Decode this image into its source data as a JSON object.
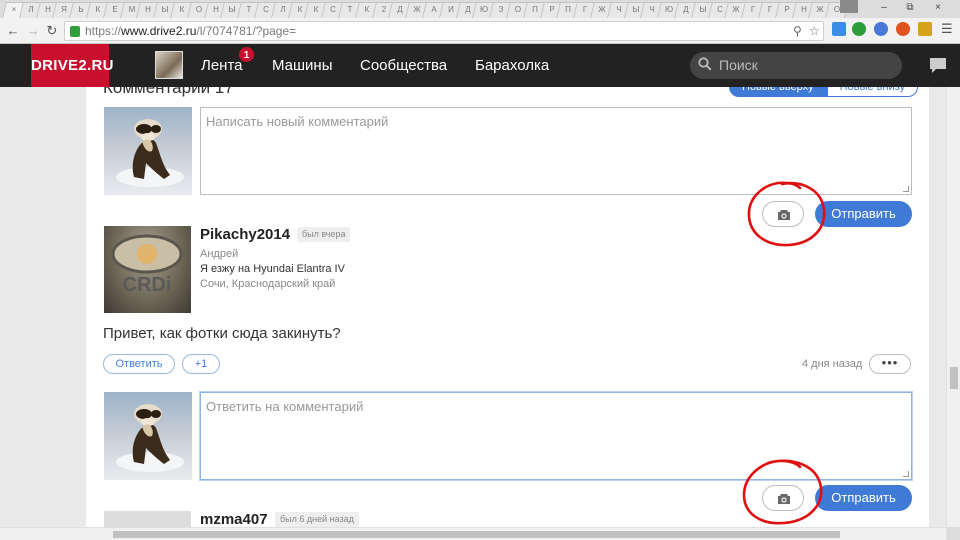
{
  "browser": {
    "url_prefix": "https://",
    "url_host": "www.drive2.ru",
    "url_path": "/l/7074781/?page=",
    "tab_glyphs": [
      "×",
      "Л",
      "Н",
      "Я",
      "Ь",
      "К",
      "Е",
      "М",
      "Н",
      "Ы",
      "К",
      "О",
      "Н",
      "Ы",
      "Т",
      "С",
      "Л",
      "К",
      "К",
      "С",
      "Т",
      "К",
      "2",
      "Д",
      "Ж",
      "А",
      "И",
      "Д",
      "Ю",
      "З",
      "О",
      "П",
      "Р",
      "П",
      "Г",
      "Ж",
      "Ч",
      "Ы",
      "Ч",
      "Ю",
      "Д",
      "Ы",
      "С",
      "Ж",
      "Г",
      "Г",
      "Р",
      "Н",
      "Ж",
      "О"
    ],
    "window_controls": [
      "–",
      "⧉",
      "×"
    ]
  },
  "header": {
    "logo": "DRIVE2.RU",
    "nav": [
      "Лента",
      "Машины",
      "Сообщества",
      "Барахолка"
    ],
    "notification_count": "1",
    "search_placeholder": "Поиск"
  },
  "comments_section": {
    "title_partial": "Комментарии  17",
    "sort_options": [
      "Новые вверху",
      "Новые внизу"
    ],
    "new_comment_placeholder": "Написать новый комментарий",
    "send_label": "Отправить"
  },
  "comment": {
    "username": "Pikachy2014",
    "last_seen": "был вчера",
    "real_name": "Андрей",
    "car": "Я езжу на Hyundai Elantra IV",
    "location": "Сочи, Краснодарский край",
    "text": "Привет, как фотки сюда закинуть?",
    "reply_label": "Ответить",
    "like_label": "+1",
    "time": "4 дня назад",
    "more_label": "•••",
    "reply_placeholder": "Ответить на комментарий",
    "photo_text": "CRDi"
  },
  "next_comment": {
    "username": "mzma407",
    "last_seen": "был 6 дней назад"
  },
  "colors": {
    "brand_red": "#c8102e",
    "accent_blue": "#3f7bd6",
    "annotation_red": "#e01010"
  }
}
